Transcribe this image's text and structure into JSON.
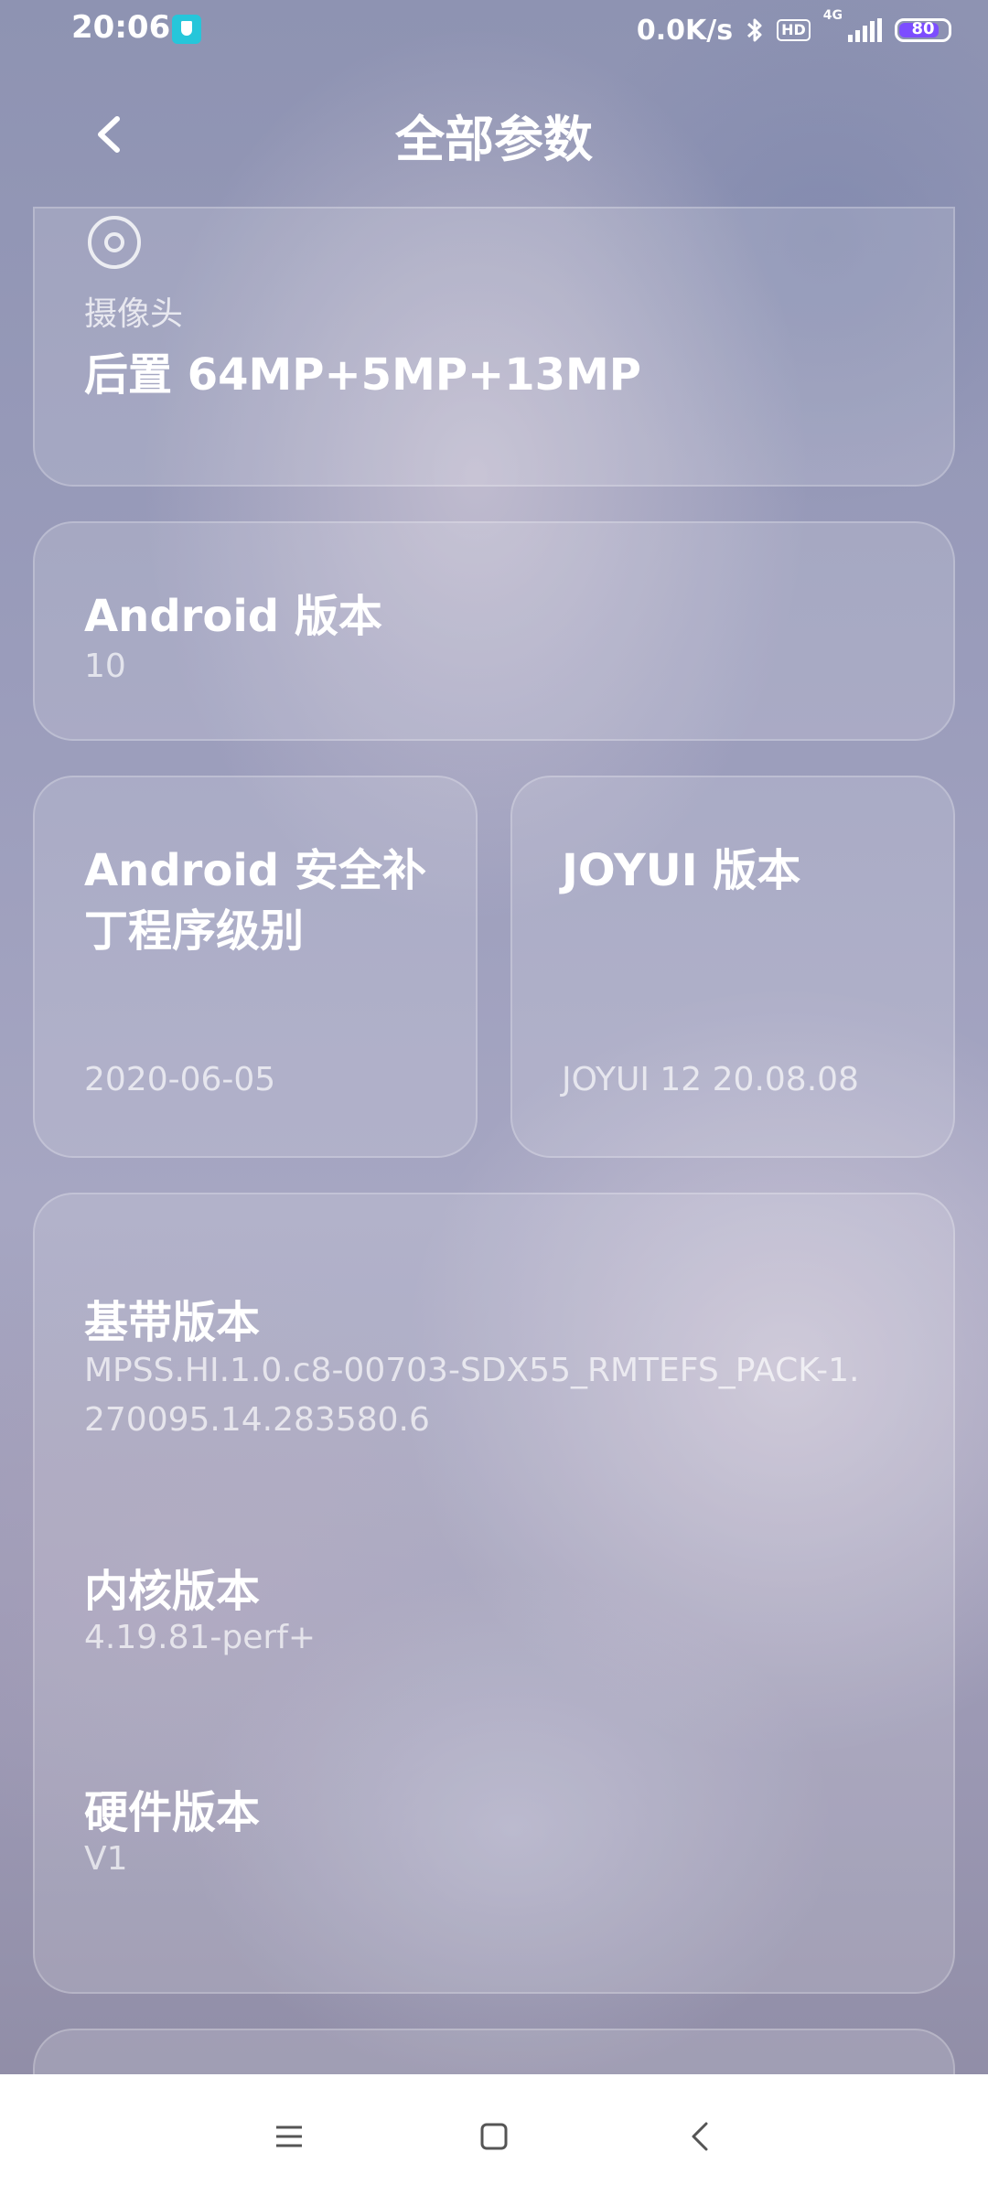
{
  "status_bar": {
    "time": "20:06",
    "net_speed": "0.0K/s",
    "bluetooth_icon": "bluetooth-icon",
    "hd_label": "HD",
    "network_type": "4G",
    "battery": "80",
    "battery_level_fraction": 0.8
  },
  "header": {
    "title": "全部参数",
    "back_icon": "chevron-left-icon"
  },
  "camera": {
    "icon": "camera-icon",
    "label": "摄像头",
    "value": "后置 64MP+5MP+13MP"
  },
  "android_version": {
    "label": "Android 版本",
    "value": "10"
  },
  "security_patch": {
    "label_line1": "Android 安全补",
    "label_line2": "丁程序级别",
    "value": "2020-06-05"
  },
  "joyui_version": {
    "label": "JOYUI 版本",
    "value": "JOYUI 12 20.08.08"
  },
  "details": [
    {
      "label": "基带版本",
      "value_line1": "MPSS.HI.1.0.c8-00703-SDX55_RMTEFS_PACK-1.",
      "value_line2": "270095.14.283580.6"
    },
    {
      "label": "内核版本",
      "value_line1": "4.19.81-perf+"
    },
    {
      "label": "硬件版本",
      "value_line1": "V1"
    }
  ],
  "navbar": {
    "menu_icon": "menu-icon",
    "home_icon": "home-icon",
    "back_icon": "back-icon"
  },
  "colors": {
    "accent_shield": "#26c6da",
    "battery_fill": "#7c4dff"
  }
}
